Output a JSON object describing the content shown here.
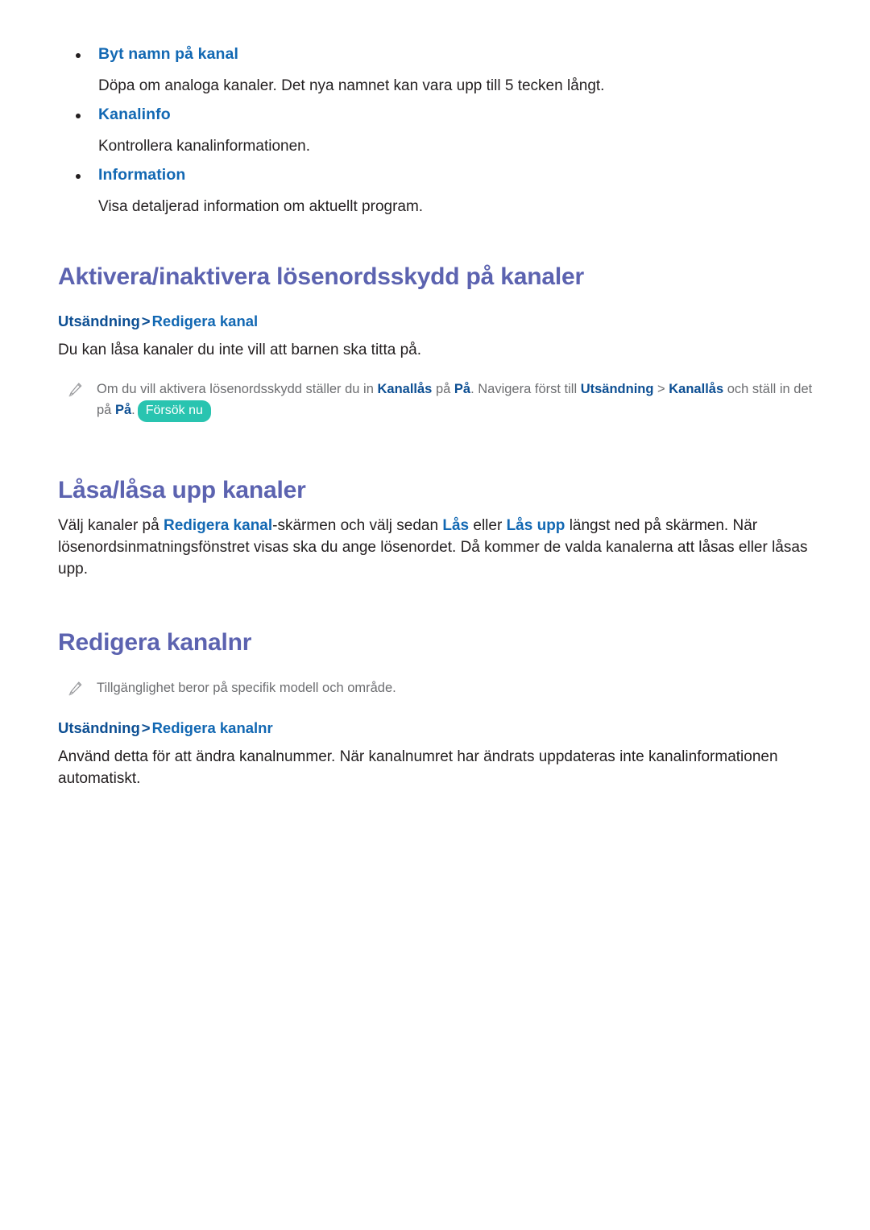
{
  "bullets": [
    {
      "label": "Byt namn på kanal",
      "description": "Döpa om analoga kanaler. Det nya namnet kan vara upp till 5 tecken långt."
    },
    {
      "label": "Kanalinfo",
      "description": "Kontrollera kanalinformationen."
    },
    {
      "label": "Information",
      "description": "Visa detaljerad information om aktuellt program."
    }
  ],
  "sections": [
    {
      "title": "Aktivera/inaktivera lösenordsskydd på kanaler",
      "breadcrumb": {
        "root": "Utsändning",
        "separator": ">",
        "leaf": "Redigera kanal"
      },
      "body": "Du kan låsa kanaler du inte vill att barnen ska titta på.",
      "note": {
        "icon": "pencil-icon",
        "part1": "Om du vill aktivera lösenordsskydd ställer du in ",
        "kw1": "Kanallås",
        "part2": " på ",
        "kw2": "På",
        "part3": ". Navigera först till ",
        "kw3": "Utsändning",
        "sep": " > ",
        "kw4": "Kanallås",
        "part4": " och ställ in det på ",
        "kw5": "På",
        "part5": ".",
        "badge": "Försök nu"
      }
    },
    {
      "title": "Låsa/låsa upp kanaler",
      "body_part1": "Välj kanaler på ",
      "body_kw1": "Redigera kanal",
      "body_part2": "-skärmen och välj sedan ",
      "body_kw2": "Lås",
      "body_part3": " eller ",
      "body_kw3": "Lås upp",
      "body_part4": " längst ned på skärmen. När lösenordsinmatningsfönstret visas ska du ange lösenordet. Då kommer de valda kanalerna att låsas eller låsas upp."
    },
    {
      "title": "Redigera kanalnr",
      "note": {
        "icon": "pencil-icon",
        "text": "Tillgänglighet beror på specifik modell och område."
      },
      "breadcrumb": {
        "root": "Utsändning",
        "separator": ">",
        "leaf": "Redigera kanalnr"
      },
      "body": "Använd detta för att ändra kanalnummer. När kanalnumret har ändrats uppdateras inte kanalinformationen automatiskt."
    }
  ],
  "colors": {
    "heading": "#5c63b0",
    "link_blue": "#1268b3",
    "crumb_root": "#0d4f93",
    "body": "#231f20",
    "note_gray": "#6d6e71",
    "badge_teal": "#29c4b0"
  }
}
